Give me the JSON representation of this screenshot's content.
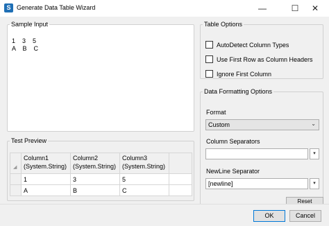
{
  "window": {
    "title": "Generate Data Table Wizard",
    "icon": "app-icon",
    "controls": {
      "minimize": "—",
      "maximize": "☐",
      "close": "✕"
    }
  },
  "sample_input": {
    "legend": "Sample Input",
    "text": "1    3    5\nA    B    C"
  },
  "test_preview": {
    "legend": "Test Preview",
    "columns": [
      {
        "name": "Column1",
        "type": "(System.String)"
      },
      {
        "name": "Column2",
        "type": "(System.String)"
      },
      {
        "name": "Column3",
        "type": "(System.String)"
      }
    ],
    "rows": [
      [
        "1",
        "3",
        "5"
      ],
      [
        "A",
        "B",
        "C"
      ]
    ]
  },
  "table_options": {
    "legend": "Table Options",
    "checkboxes": [
      {
        "label": "AutoDetect Column Types",
        "checked": false
      },
      {
        "label": "Use First Row as Column Headers",
        "checked": false
      },
      {
        "label": "Ignore First Column",
        "checked": false
      }
    ]
  },
  "data_formatting": {
    "legend": "Data Formatting Options",
    "format_label": "Format",
    "format_value": "Custom",
    "column_separators_label": "Column Separators",
    "column_separators_value": "",
    "newline_separator_label": "NewLine Separator",
    "newline_separator_value": "[newline]",
    "reset_label": "Reset"
  },
  "footer": {
    "ok_label": "OK",
    "cancel_label": "Cancel"
  }
}
